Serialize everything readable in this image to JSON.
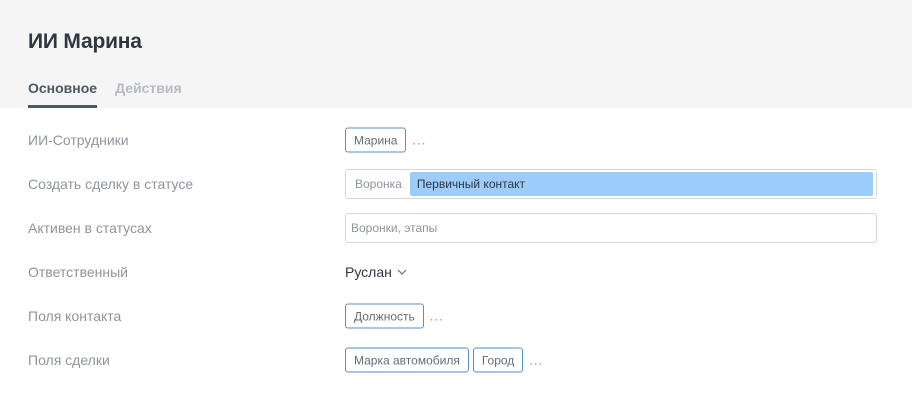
{
  "header": {
    "title": "ИИ Марина",
    "tabs": [
      {
        "label": "Основное",
        "active": true
      },
      {
        "label": "Действия",
        "active": false
      }
    ]
  },
  "form": {
    "ai_employees": {
      "label": "ИИ-Сотрудники",
      "tags": [
        "Марина"
      ],
      "more": "..."
    },
    "create_deal_status": {
      "label": "Создать сделку в статусе",
      "prefix": "Воронка",
      "value": "Первичный контакт"
    },
    "active_in_statuses": {
      "label": "Активен в статусах",
      "placeholder": "Воронки, этапы"
    },
    "responsible": {
      "label": "Ответственный",
      "value": "Руслан"
    },
    "contact_fields": {
      "label": "Поля контакта",
      "tags": [
        "Должность"
      ],
      "more": "..."
    },
    "deal_fields": {
      "label": "Поля сделки",
      "tags": [
        "Марка автомобиля",
        "Город"
      ],
      "more": "..."
    }
  },
  "colors": {
    "header_bg": "#f5f5f5",
    "accent_chip": "#9ccdfa",
    "tag_border": "#5a8fc4",
    "label_text": "#8e959c"
  }
}
